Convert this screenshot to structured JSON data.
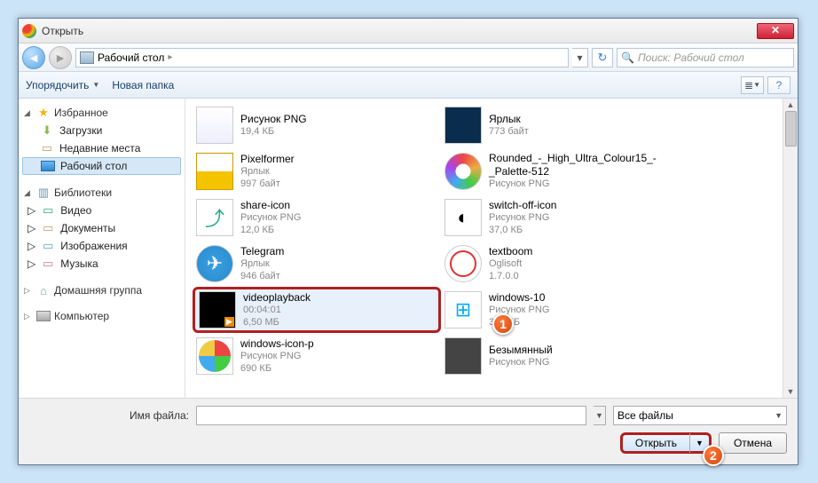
{
  "window": {
    "title": "Открыть"
  },
  "nav": {
    "location": "Рабочий стол",
    "search_placeholder": "Поиск: Рабочий стол"
  },
  "toolbar": {
    "organize": "Упорядочить",
    "newfolder": "Новая папка"
  },
  "sidebar": {
    "favorites": {
      "label": "Избранное",
      "items": [
        {
          "label": "Загрузки"
        },
        {
          "label": "Недавние места"
        },
        {
          "label": "Рабочий стол"
        }
      ]
    },
    "libraries": {
      "label": "Библиотеки",
      "items": [
        {
          "label": "Видео"
        },
        {
          "label": "Документы"
        },
        {
          "label": "Изображения"
        },
        {
          "label": "Музыка"
        }
      ]
    },
    "homegroup": {
      "label": "Домашняя группа"
    },
    "computer": {
      "label": "Компьютер"
    }
  },
  "files": {
    "col1": [
      {
        "name": "Рисунок PNG",
        "type": "",
        "size": "19,4 КБ",
        "thumb": "png"
      },
      {
        "name": "Pixelformer",
        "type": "Ярлык",
        "size": "997 байт",
        "thumb": "pf"
      },
      {
        "name": "share-icon",
        "type": "Рисунок PNG",
        "size": "12,0 КБ",
        "thumb": "share"
      },
      {
        "name": "Telegram",
        "type": "Ярлык",
        "size": "946 байт",
        "thumb": "tg"
      },
      {
        "name": "videoplayback",
        "type": "00:04:01",
        "size": "6,50 МБ",
        "thumb": "vid",
        "selected": true
      },
      {
        "name": "windows-icon-p",
        "type": "Рисунок PNG",
        "size": "690 КБ",
        "thumb": "win7"
      }
    ],
    "col2": [
      {
        "name": "Ярлык",
        "type": "",
        "size": "773 байт",
        "thumb": "ps"
      },
      {
        "name": "Rounded_-_High_Ultra_Colour15_-_Palette-512",
        "type": "Рисунок PNG",
        "size": "",
        "thumb": "pal"
      },
      {
        "name": "switch-off-icon",
        "type": "Рисунок PNG",
        "size": "37,0 КБ",
        "thumb": "switch"
      },
      {
        "name": "textboom",
        "type": "Oglisoft",
        "size": "1.7.0.0",
        "thumb": "tb"
      },
      {
        "name": "windows-10",
        "type": "Рисунок PNG",
        "size": "374 КБ",
        "thumb": "win10"
      },
      {
        "name": "Безымянный",
        "type": "Рисунок PNG",
        "size": "",
        "thumb": "blank"
      }
    ]
  },
  "footer": {
    "filename_label": "Имя файла:",
    "filter": "Все файлы",
    "open": "Открыть",
    "cancel": "Отмена"
  },
  "markers": {
    "m1": "1",
    "m2": "2"
  }
}
